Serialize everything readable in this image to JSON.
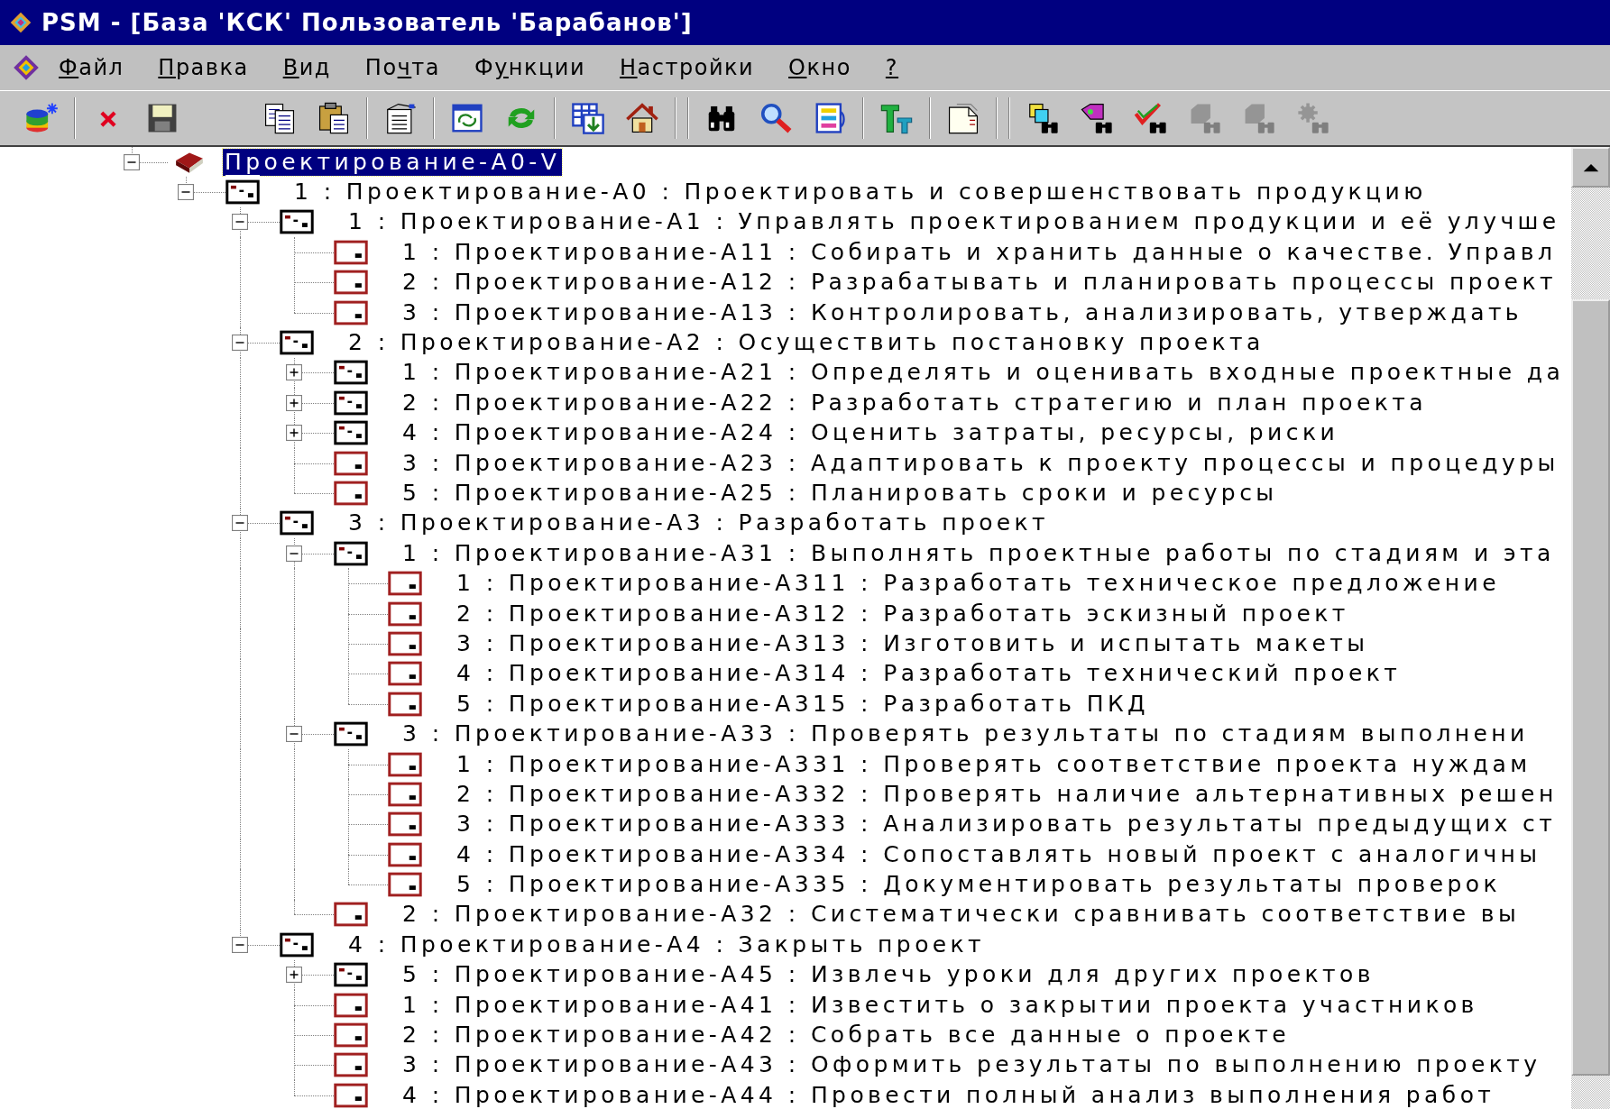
{
  "window": {
    "title": "PSM - [База 'КСК' Пользователь 'Барабанов']"
  },
  "menu": [
    {
      "key": "Ф",
      "post": "айл"
    },
    {
      "key": "П",
      "post": "равка"
    },
    {
      "key": "В",
      "post": "ид"
    },
    {
      "pre": "По",
      "key": "ч",
      "post": "та"
    },
    {
      "pre": "Ф",
      "key": "у",
      "post": "нкции"
    },
    {
      "key": "Н",
      "post": "астройки"
    },
    {
      "key": "О",
      "post": "кно"
    },
    {
      "key": "?"
    }
  ],
  "toolbar": [
    {
      "kind": "database",
      "disabled": false
    },
    {
      "kind": "separator"
    },
    {
      "kind": "delete",
      "disabled": false
    },
    {
      "kind": "save",
      "disabled": false
    },
    {
      "kind": "gap"
    },
    {
      "kind": "copy",
      "disabled": false
    },
    {
      "kind": "paste",
      "disabled": false
    },
    {
      "kind": "separator"
    },
    {
      "kind": "properties",
      "disabled": false
    },
    {
      "kind": "separator"
    },
    {
      "kind": "window-refresh",
      "disabled": false
    },
    {
      "kind": "refresh",
      "disabled": false
    },
    {
      "kind": "separator"
    },
    {
      "kind": "table-insert",
      "disabled": false
    },
    {
      "kind": "home",
      "disabled": false
    },
    {
      "kind": "separator2"
    },
    {
      "kind": "binoculars",
      "disabled": false
    },
    {
      "kind": "search",
      "disabled": false
    },
    {
      "kind": "list",
      "disabled": false
    },
    {
      "kind": "separator"
    },
    {
      "kind": "tool",
      "disabled": false
    },
    {
      "kind": "separator"
    },
    {
      "kind": "page",
      "disabled": false
    },
    {
      "kind": "separator2"
    },
    {
      "kind": "find-shapes",
      "disabled": false
    },
    {
      "kind": "find-tag",
      "disabled": false
    },
    {
      "kind": "find-check",
      "disabled": false
    },
    {
      "kind": "find-block",
      "disabled": true
    },
    {
      "kind": "find-block",
      "disabled": true
    },
    {
      "kind": "find-gear",
      "disabled": true
    }
  ],
  "tree": [
    {
      "kind": "model",
      "label": "Проектирование-А0-V",
      "selected": true,
      "expanded": true,
      "children": [
        {
          "kind": "decomposed",
          "label": "1 : Проектирование-А0 : Проектировать и совершенствовать продукцию",
          "selected": false,
          "expanded": true,
          "children": [
            {
              "kind": "decomposed",
              "label": "1 : Проектирование-А1 : Управлять проектированием продукции и её улучше",
              "selected": false,
              "expanded": true,
              "children": [
                {
                  "kind": "leaf",
                  "label": "1 : Проектирование-А11 : Собирать и хранить данные о качестве. Управл",
                  "selected": false
                },
                {
                  "kind": "leaf",
                  "label": "2 : Проектирование-А12 : Разрабатывать и планировать процессы проект",
                  "selected": false
                },
                {
                  "kind": "leaf",
                  "label": "3 : Проектирование-А13 : Контролировать, анализировать, утверждать",
                  "selected": false
                }
              ]
            },
            {
              "kind": "decomposed",
              "label": "2 : Проектирование-А2 : Осуществить постановку проекта",
              "selected": false,
              "expanded": true,
              "children": [
                {
                  "kind": "decomposed",
                  "label": "1 : Проектирование-А21 : Определять и оценивать входные проектные да",
                  "selected": false,
                  "expanded": false
                },
                {
                  "kind": "decomposed",
                  "label": "2 : Проектирование-А22 : Разработать стратегию и план проекта",
                  "selected": false,
                  "expanded": false
                },
                {
                  "kind": "decomposed",
                  "label": "4 : Проектирование-А24 : Оценить затраты, ресурсы, риски",
                  "selected": false,
                  "expanded": false
                },
                {
                  "kind": "leaf",
                  "label": "3 : Проектирование-А23 : Адаптировать к проекту процессы и процедуры",
                  "selected": false
                },
                {
                  "kind": "leaf",
                  "label": "5 : Проектирование-А25 : Планировать сроки и ресурсы",
                  "selected": false
                }
              ]
            },
            {
              "kind": "decomposed",
              "label": "3 : Проектирование-А3 : Разработать проект",
              "selected": false,
              "expanded": true,
              "children": [
                {
                  "kind": "decomposed",
                  "label": "1 : Проектирование-А31 : Выполнять проектные работы по стадиям и эта",
                  "selected": false,
                  "expanded": true,
                  "children": [
                    {
                      "kind": "leaf",
                      "label": "1 : Проектирование-А311 : Разработать техническое предложение",
                      "selected": false
                    },
                    {
                      "kind": "leaf",
                      "label": "2 : Проектирование-А312 : Разработать эскизный проект",
                      "selected": false
                    },
                    {
                      "kind": "leaf",
                      "label": "3 : Проектирование-А313 : Изготовить и испытать макеты",
                      "selected": false
                    },
                    {
                      "kind": "leaf",
                      "label": "4 : Проектирование-А314 : Разработать технический проект",
                      "selected": false
                    },
                    {
                      "kind": "leaf",
                      "label": "5 : Проектирование-А315 : Разработать ПКД",
                      "selected": false
                    }
                  ]
                },
                {
                  "kind": "decomposed",
                  "label": "3 : Проектирование-А33 : Проверять результаты по стадиям выполнени",
                  "selected": false,
                  "expanded": true,
                  "children": [
                    {
                      "kind": "leaf",
                      "label": "1 : Проектирование-А331 : Проверять соответствие проекта нуждам",
                      "selected": false
                    },
                    {
                      "kind": "leaf",
                      "label": "2 : Проектирование-А332 : Проверять наличие альтернативных решен",
                      "selected": false
                    },
                    {
                      "kind": "leaf",
                      "label": "3 : Проектирование-А333 : Анализировать результаты предыдущих ст",
                      "selected": false
                    },
                    {
                      "kind": "leaf",
                      "label": "4 : Проектирование-А334 : Сопоставлять новый проект с аналогичны",
                      "selected": false
                    },
                    {
                      "kind": "leaf",
                      "label": "5 : Проектирование-А335 : Документировать результаты проверок",
                      "selected": false
                    }
                  ]
                },
                {
                  "kind": "leaf",
                  "label": "2 : Проектирование-А32 : Систематически сравнивать соответствие вы",
                  "selected": false
                }
              ]
            },
            {
              "kind": "decomposed",
              "label": "4 : Проектирование-А4 : Закрыть проект",
              "selected": false,
              "expanded": true,
              "children": [
                {
                  "kind": "decomposed",
                  "label": "5 : Проектирование-А45 : Извлечь уроки для других проектов",
                  "selected": false,
                  "expanded": false
                },
                {
                  "kind": "leaf",
                  "label": "1 : Проектирование-А41 : Известить о закрытии проекта участников",
                  "selected": false
                },
                {
                  "kind": "leaf",
                  "label": "2 : Проектирование-А42 : Собрать все данные о проекте",
                  "selected": false
                },
                {
                  "kind": "leaf",
                  "label": "3 : Проектирование-А43 : Оформить результаты по выполнению проекту",
                  "selected": false
                },
                {
                  "kind": "leaf",
                  "label": "4 : Проектирование-А44 : Провести полный анализ выполнения работ",
                  "selected": false
                }
              ]
            }
          ]
        }
      ]
    }
  ]
}
